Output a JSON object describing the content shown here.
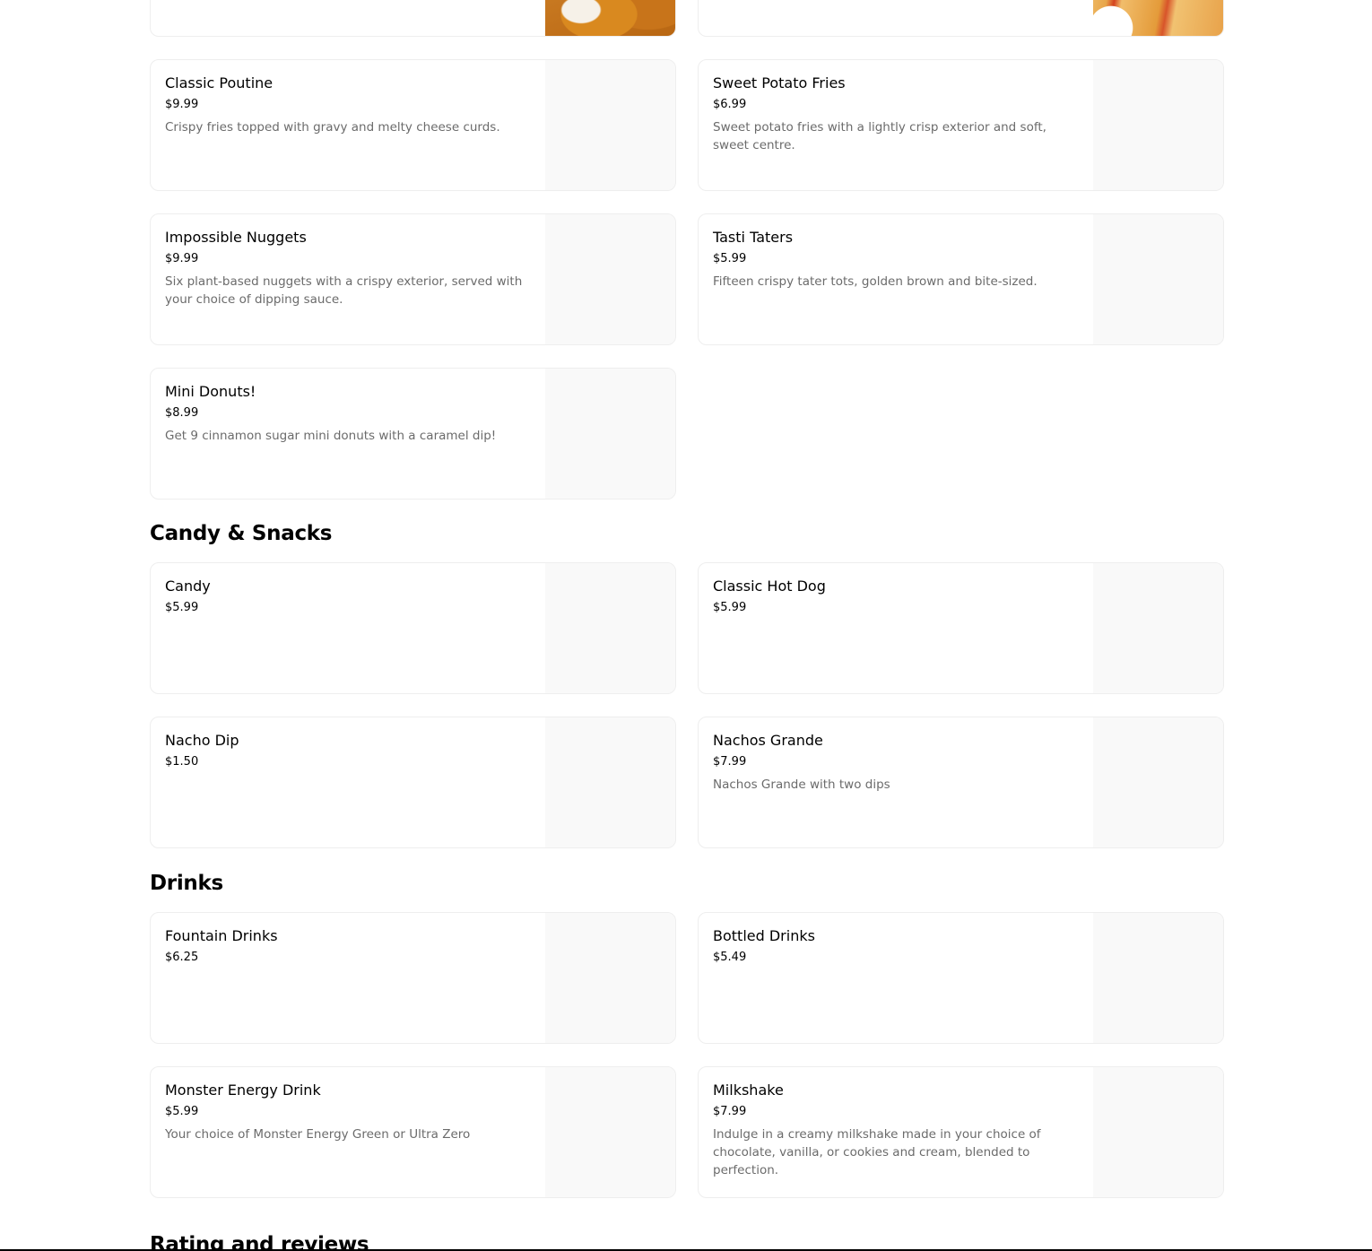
{
  "sections": {
    "fries_and_sides": {
      "items": [
        {
          "name": "Classic Poutine",
          "price": "$9.99",
          "description": "Crispy fries topped with gravy and melty cheese curds."
        },
        {
          "name": "Sweet Potato Fries",
          "price": "$6.99",
          "description": "Sweet potato fries with a lightly crisp exterior and soft, sweet centre."
        },
        {
          "name": "Impossible Nuggets",
          "price": "$9.99",
          "description": "Six plant-based nuggets with a crispy exterior, served with your choice of dipping sauce."
        },
        {
          "name": "Tasti Taters",
          "price": "$5.99",
          "description": "Fifteen crispy tater tots, golden brown and bite-sized."
        },
        {
          "name": "Mini Donuts!",
          "price": "$8.99",
          "description": "Get 9 cinnamon sugar mini donuts with a caramel dip!"
        }
      ]
    },
    "candy_and_snacks": {
      "title": "Candy & Snacks",
      "items": [
        {
          "name": "Candy",
          "price": "$5.99",
          "description": ""
        },
        {
          "name": "Classic Hot Dog",
          "price": "$5.99",
          "description": ""
        },
        {
          "name": "Nacho Dip",
          "price": "$1.50",
          "description": ""
        },
        {
          "name": "Nachos Grande",
          "price": "$7.99",
          "description": "Nachos Grande with two dips"
        }
      ]
    },
    "drinks": {
      "title": "Drinks",
      "items": [
        {
          "name": "Fountain Drinks",
          "price": "$6.25",
          "description": ""
        },
        {
          "name": "Bottled Drinks",
          "price": "$5.49",
          "description": ""
        },
        {
          "name": "Monster Energy Drink",
          "price": "$5.99",
          "description": "Your choice of Monster Energy Green or Ultra Zero"
        },
        {
          "name": "Milkshake",
          "price": "$7.99",
          "description": "Indulge in a creamy milkshake made in your choice of chocolate, vanilla, or cookies and cream, blended to perfection."
        }
      ]
    },
    "reviews": {
      "title": "Rating and reviews"
    }
  },
  "colors": {
    "text_primary": "#000000",
    "text_secondary": "#6b6b6b",
    "card_border": "#eeeeee",
    "image_placeholder": "#f9f9f9"
  }
}
